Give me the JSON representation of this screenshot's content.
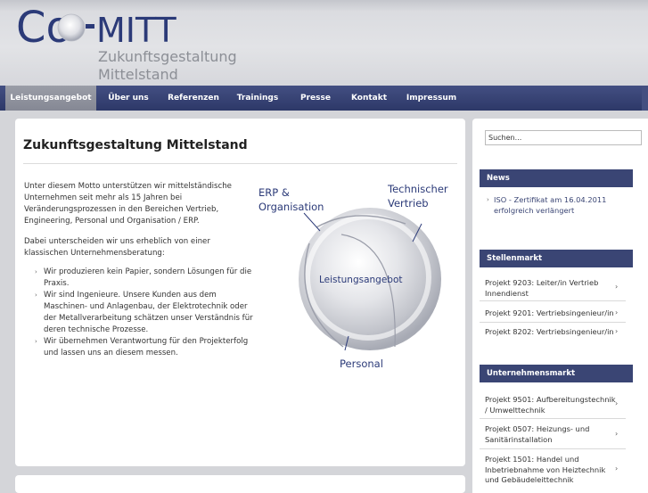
{
  "logo": {
    "letters_co": "Co",
    "letters_mitt": "MITT",
    "sub_line1": "Zukunftsgestaltung",
    "sub_line2": "Mittelstand"
  },
  "nav": {
    "items": [
      {
        "label": "Leistungsangebot",
        "active": true
      },
      {
        "label": "Über uns"
      },
      {
        "label": "Referenzen"
      },
      {
        "label": "Trainings"
      },
      {
        "label": "Presse"
      },
      {
        "label": "Kontakt"
      },
      {
        "label": "Impressum"
      }
    ]
  },
  "main": {
    "title": "Zukunftsgestaltung Mittelstand",
    "intro": "Unter diesem Motto unterstützen wir mittelständische Unternehmen seit mehr als 15 Jahren bei Veränderungsprozessen in den Bereichen Vertrieb, Engineering, Personal und Organisation / ERP.",
    "intro2": "Dabei unterscheiden wir uns erheblich von einer klassischen Unternehmensberatung:",
    "bullets": [
      "Wir produzieren kein Papier, sondern Lösungen für die Praxis.",
      "Wir sind Ingenieure. Unsere Kunden aus dem Maschinen- und Anlagenbau, der Elektrotechnik oder der Metallverarbeitung schätzen unser Verständnis für deren technische Prozesse.",
      "Wir übernehmen Verantwortung für den Projekterfolg und lassen uns an diesem messen."
    ],
    "bullet_arrow": "›",
    "diagram": {
      "erp_line1": "ERP &",
      "erp_line2": "Organisation",
      "tech_line1": "Technischer",
      "tech_line2": "Vertrieb",
      "center": "Leistungsangebot",
      "personal": "Personal",
      "colors": {
        "text": "#2b3a78",
        "sphere": "#c9cbd1"
      }
    }
  },
  "sidebar": {
    "search_value": "Suchen...",
    "news": {
      "title": "News",
      "items": [
        "ISO - Zertifikat am 16.04.2011 erfolgreich verlängert"
      ]
    },
    "stellenmarkt": {
      "title": "Stellenmarkt",
      "items": [
        "Projekt 9203: Leiter/in Vertrieb Innendienst",
        "Projekt 9201: Vertriebsingenieur/in",
        "Projekt 8202: Vertriebsingenieur/in"
      ]
    },
    "unternehmensmarkt": {
      "title": "Unternehmensmarkt",
      "items": [
        "Projekt 9501: Aufbereitungstechnik / Umwelttechnik",
        "Projekt 0507: Heizungs- und Sanitärinstallation",
        "Projekt 1501: Handel und Inbetriebnahme von Heiztechnik und Gebäudeleittechnik"
      ]
    },
    "arrow": "›"
  },
  "colors": {
    "nav_bg": "#2d3868",
    "nav_active": "#8b8e99",
    "widget_head": "#3a4574",
    "logo_blue": "#2b3a78"
  }
}
